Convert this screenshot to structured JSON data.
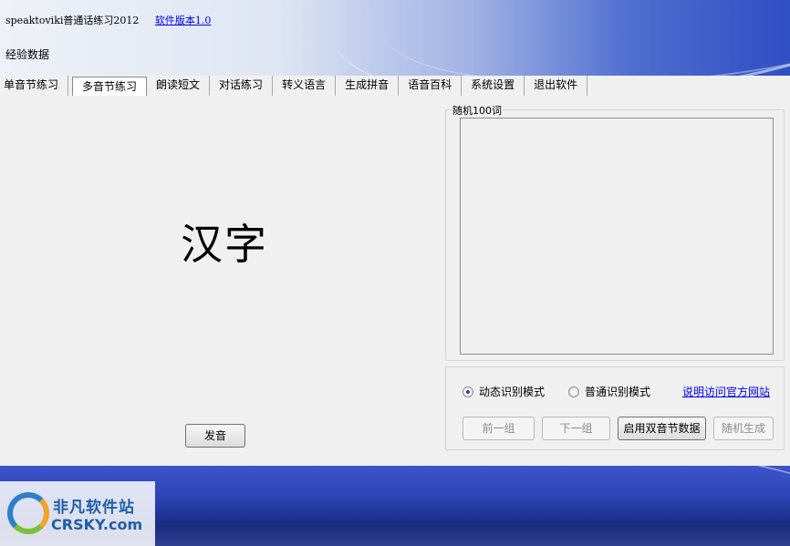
{
  "window": {
    "app_title": "speaktoviki普通话练习2012",
    "version_link": "软件版本1.0",
    "experience_label": "经验数据"
  },
  "tabs": [
    {
      "label": "单音节练习",
      "active": false
    },
    {
      "label": "多音节练习",
      "active": true
    },
    {
      "label": "朗读短文",
      "active": false
    },
    {
      "label": "对话练习",
      "active": false
    },
    {
      "label": "转义语言",
      "active": false
    },
    {
      "label": "生成拼音",
      "active": false
    },
    {
      "label": "语音百科",
      "active": false
    },
    {
      "label": "系统设置",
      "active": false
    },
    {
      "label": "退出软件",
      "active": false
    }
  ],
  "practice": {
    "word": "汉字",
    "pronounce_button": "发音"
  },
  "random_words": {
    "legend": "随机100词"
  },
  "mode": {
    "dynamic_label": "动态识别模式",
    "normal_label": "普通识别模式",
    "selected": "dynamic",
    "help_link": "说明访问官方网站"
  },
  "actions": {
    "prev": "前一组",
    "next": "下一组",
    "enable_double": "启用双音节数据",
    "random": "随机生成"
  },
  "watermark": {
    "cn": "非凡软件站",
    "en": "CRSKY.com"
  },
  "colors": {
    "link": "#0000ee",
    "banner_blue": "#2f4fc4"
  }
}
